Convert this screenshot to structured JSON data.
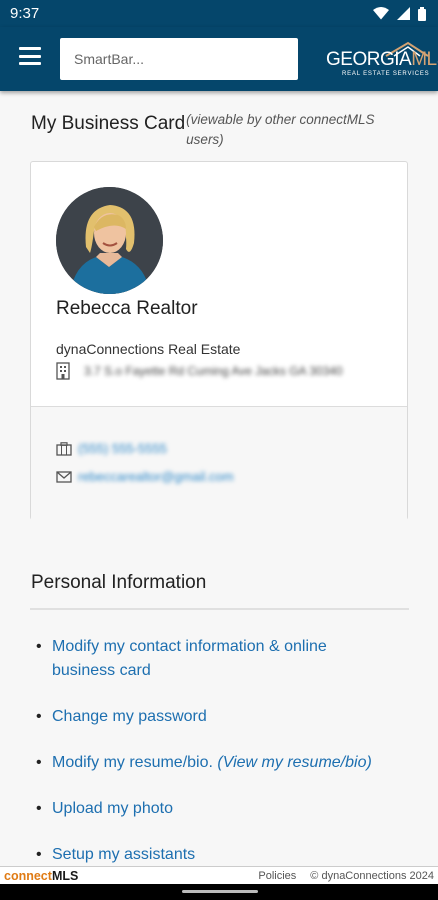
{
  "status_bar": {
    "time": "9:37",
    "icons": [
      "wifi-icon",
      "signal-icon",
      "battery-icon"
    ]
  },
  "header": {
    "menu_icon": "hamburger-menu-icon",
    "search_placeholder": "SmartBar...",
    "logo": {
      "main_part1": "GEORGIA",
      "main_part2": "MLS",
      "sub": "REAL ESTATE SERVICES"
    }
  },
  "business_card": {
    "title": "My Business Card",
    "note": "(viewable by other connectMLS users)",
    "name": "Rebecca Realtor",
    "company": "dynaConnections Real Estate",
    "address": "3.7 S.o Fayette Rd Cuming Ave Jacks GA 30340",
    "phone": "(555) 555-5555",
    "email": "rebeccarealtor@gmail.com"
  },
  "personal_info": {
    "title": "Personal Information",
    "links": [
      {
        "label": "Modify my contact information & online business card",
        "extra": ""
      },
      {
        "label": "Change my password",
        "extra": ""
      },
      {
        "label": "Modify my resume/bio.",
        "extra": "(View my resume/bio)"
      },
      {
        "label": "Upload my photo",
        "extra": ""
      },
      {
        "label": "Setup my assistants",
        "extra": ""
      }
    ]
  },
  "footer": {
    "brand_connect": "connect",
    "brand_mls": "MLS",
    "policies": "Policies",
    "copyright": "© dynaConnections 2024"
  },
  "colors": {
    "header_bg": "#05466b",
    "link": "#1d6fb0",
    "brand_orange": "#e07b14",
    "logo_accent": "#d4a373"
  }
}
